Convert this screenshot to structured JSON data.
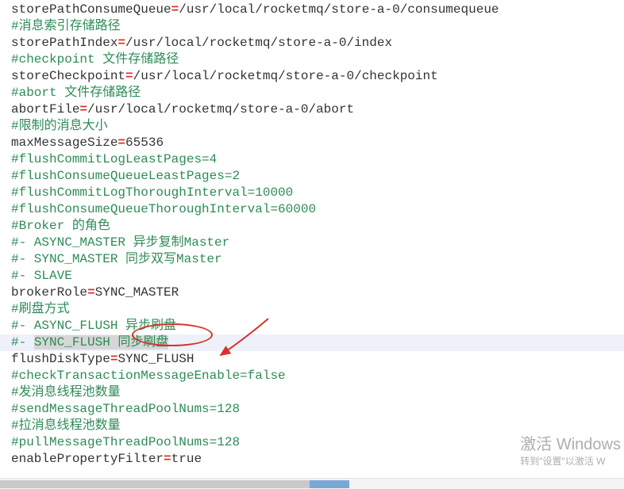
{
  "lines": [
    {
      "type": "kv",
      "key": "storePathConsumeQueue",
      "value": "/usr/local/rocketmq/store-a-0/consumequeue"
    },
    {
      "type": "comment",
      "text": "#消息索引存储路径"
    },
    {
      "type": "kv",
      "key": "storePathIndex",
      "value": "/usr/local/rocketmq/store-a-0/index"
    },
    {
      "type": "comment",
      "text": "#checkpoint 文件存储路径"
    },
    {
      "type": "kv",
      "key": "storeCheckpoint",
      "value": "/usr/local/rocketmq/store-a-0/checkpoint"
    },
    {
      "type": "comment",
      "text": "#abort 文件存储路径"
    },
    {
      "type": "kv",
      "key": "abortFile",
      "value": "/usr/local/rocketmq/store-a-0/abort"
    },
    {
      "type": "comment",
      "text": "#限制的消息大小"
    },
    {
      "type": "kv",
      "key": "maxMessageSize",
      "value": "65536"
    },
    {
      "type": "comment",
      "text": "#flushCommitLogLeastPages=4"
    },
    {
      "type": "comment",
      "text": "#flushConsumeQueueLeastPages=2"
    },
    {
      "type": "comment",
      "text": "#flushCommitLogThoroughInterval=10000"
    },
    {
      "type": "comment",
      "text": "#flushConsumeQueueThoroughInterval=60000"
    },
    {
      "type": "comment",
      "text": "#Broker 的角色"
    },
    {
      "type": "comment",
      "text": "#- ASYNC_MASTER 异步复制Master"
    },
    {
      "type": "comment",
      "text": "#- SYNC_MASTER 同步双写Master"
    },
    {
      "type": "comment",
      "text": "#- SLAVE"
    },
    {
      "type": "kv",
      "key": "brokerRole",
      "value": "SYNC_MASTER"
    },
    {
      "type": "comment",
      "text": "#刷盘方式"
    },
    {
      "type": "comment",
      "text": "#- ASYNC_FLUSH 异步刷盘"
    },
    {
      "type": "highlight",
      "pre": "#- ",
      "sel": "SYNC_FLUSH 同步刷盘"
    },
    {
      "type": "kv",
      "key": "flushDiskType",
      "value": "SYNC_FLUSH"
    },
    {
      "type": "comment",
      "text": "#checkTransactionMessageEnable=false"
    },
    {
      "type": "comment",
      "text": "#发消息线程池数量"
    },
    {
      "type": "comment",
      "text": "#sendMessageThreadPoolNums=128"
    },
    {
      "type": "comment",
      "text": "#拉消息线程池数量"
    },
    {
      "type": "comment",
      "text": "#pullMessageThreadPoolNums=128"
    },
    {
      "type": "kv",
      "key": "enablePropertyFilter",
      "value": "true"
    }
  ],
  "watermark": {
    "line1": "激活 Windows",
    "line2": "转到\"设置\"以激活 W"
  }
}
